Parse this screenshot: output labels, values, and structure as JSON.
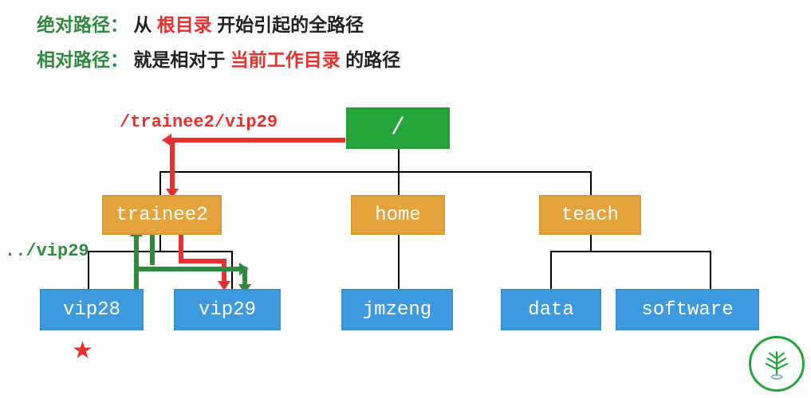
{
  "definitions": {
    "abs": {
      "term": "绝对路径：",
      "p1": "从",
      "highlight": "根目录",
      "p2": "开始引起的全路径"
    },
    "rel": {
      "term": "相对路径：",
      "p1": "就是相对于",
      "highlight": "当前工作目录",
      "p2": "的路径"
    }
  },
  "path_labels": {
    "abs_example": "/trainee2/vip29",
    "rel_example": "../vip29"
  },
  "nodes": {
    "root": "/",
    "trainee2": "trainee2",
    "home": "home",
    "teach": "teach",
    "vip28": "vip28",
    "vip29": "vip29",
    "jmzeng": "jmzeng",
    "data": "data",
    "software": "software"
  },
  "logo_alt": "生信技能树"
}
